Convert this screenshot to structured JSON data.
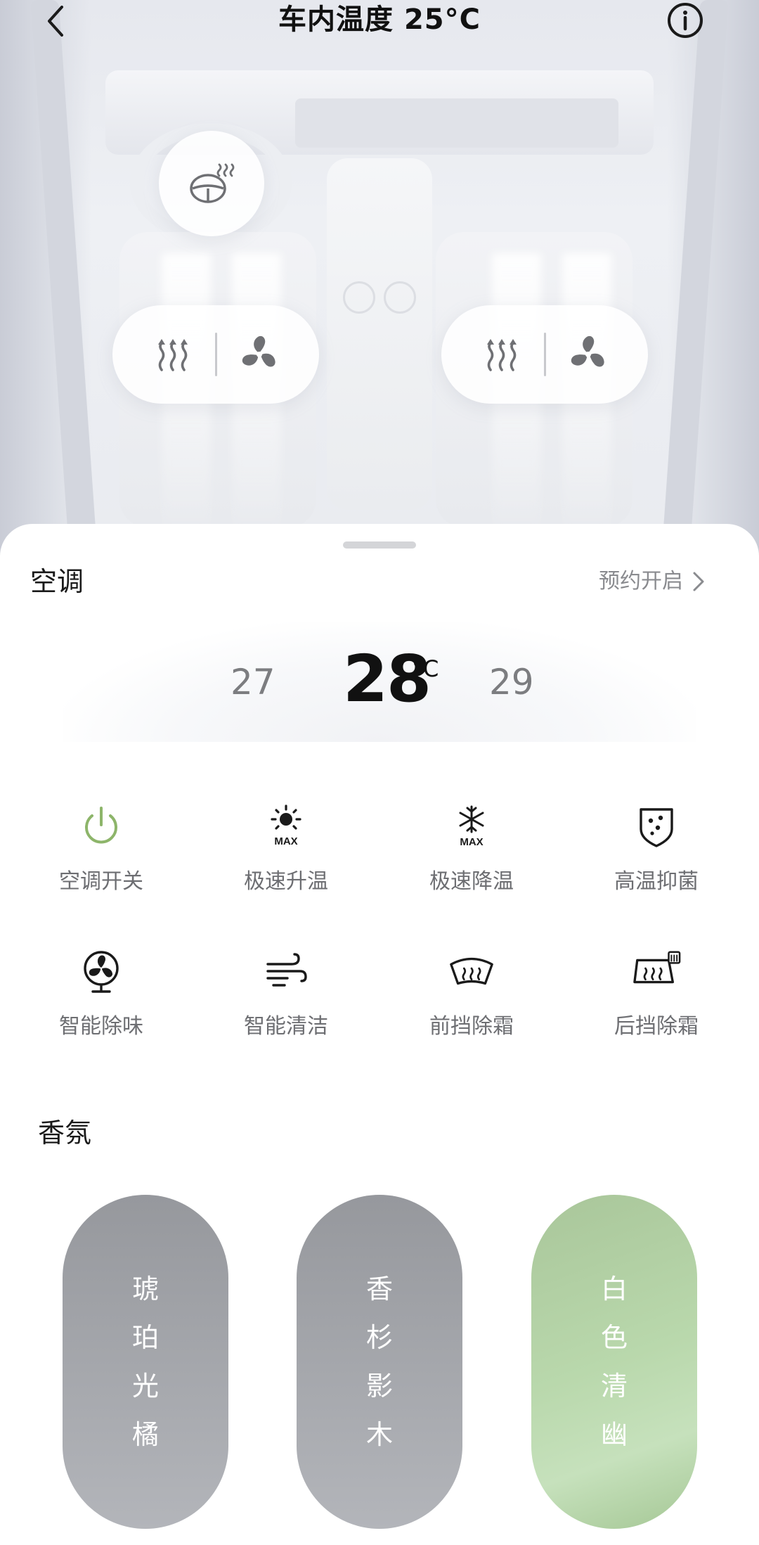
{
  "header": {
    "back_icon": "chevron-left-icon",
    "title": "车内温度 25°C",
    "info_icon": "info-circle-icon"
  },
  "car_controls": {
    "steering_heat_icon": "steering-wheel-heat-icon",
    "driver_seat": {
      "heat_icon": "seat-heat-icon",
      "vent_icon": "fan-icon"
    },
    "passenger_seat": {
      "heat_icon": "seat-heat-icon",
      "vent_icon": "fan-icon"
    }
  },
  "ac": {
    "title": "空调",
    "schedule_label": "预约开启",
    "temp_prev": "27",
    "temp_current": "28",
    "temp_unit": "°C",
    "temp_next": "29"
  },
  "controls": [
    {
      "label": "空调开关",
      "icon": "power-icon",
      "color": "#8db56a"
    },
    {
      "label": "极速升温",
      "icon": "sun-max-icon"
    },
    {
      "label": "极速降温",
      "icon": "snowflake-max-icon"
    },
    {
      "label": "高温抑菌",
      "icon": "shield-dots-icon"
    },
    {
      "label": "智能除味",
      "icon": "fan-circle-icon"
    },
    {
      "label": "智能清洁",
      "icon": "wind-icon"
    },
    {
      "label": "前挡除霜",
      "icon": "front-defrost-icon"
    },
    {
      "label": "后挡除霜",
      "icon": "rear-defrost-icon"
    }
  ],
  "fragrance": {
    "title": "香氛",
    "items": [
      {
        "name": "琥珀光橘",
        "chars": [
          "琥",
          "珀",
          "光",
          "橘"
        ]
      },
      {
        "name": "香杉影木",
        "chars": [
          "香",
          "杉",
          "影",
          "木"
        ]
      },
      {
        "name": "白色清幽",
        "chars": [
          "白",
          "色",
          "清",
          "幽"
        ],
        "active": true
      }
    ]
  },
  "colors": {
    "accent_green": "#8db56a",
    "text_muted": "#6d6e72",
    "scent_active": "#b9d8ac"
  }
}
